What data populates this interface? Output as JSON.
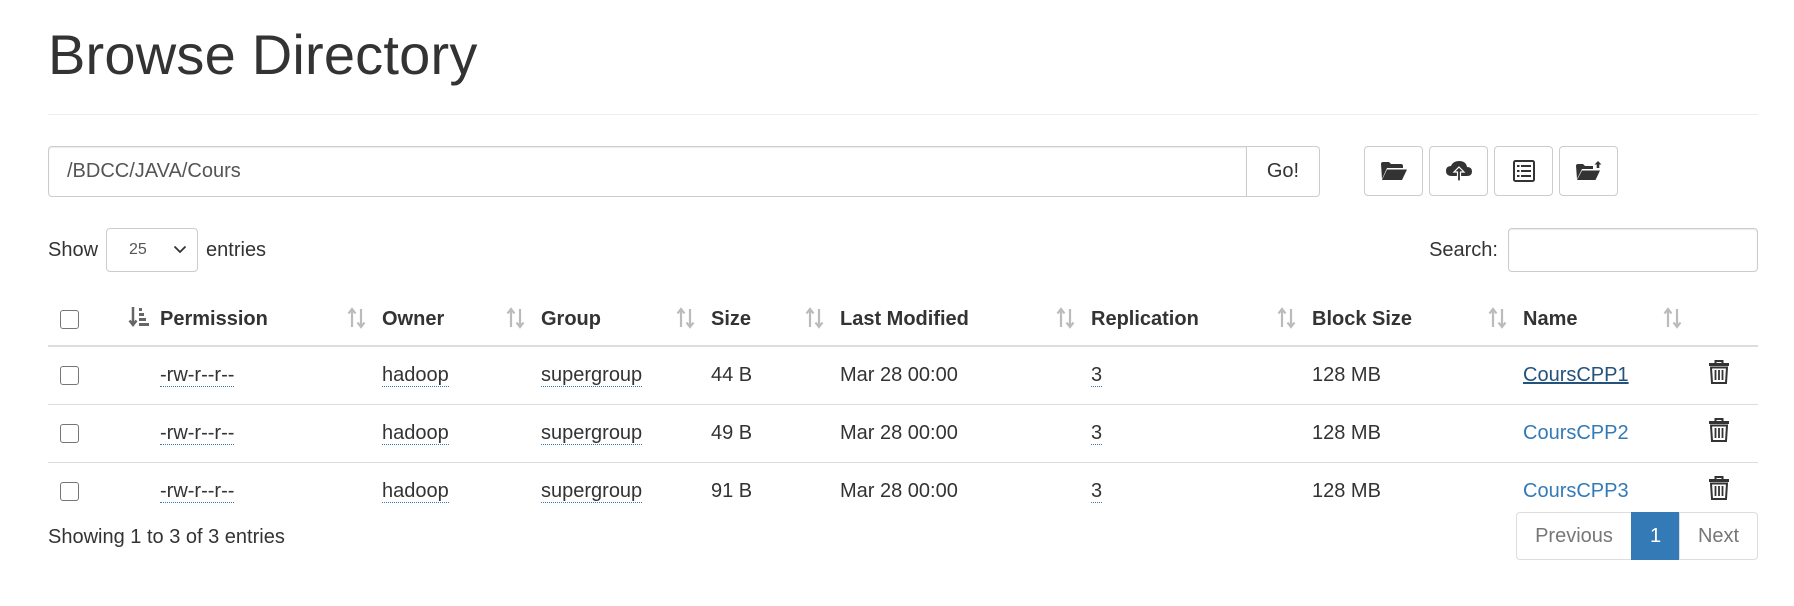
{
  "page": {
    "title": "Browse Directory"
  },
  "pathbar": {
    "path_value": "/BDCC/JAVA/Cours",
    "go_label": "Go!"
  },
  "toolbar": {
    "icons": [
      "folder-open-icon",
      "cloud-upload-icon",
      "list-alt-icon",
      "folder-move-icon"
    ]
  },
  "length": {
    "show_label": "Show",
    "selected": "25",
    "entries_label": "entries"
  },
  "search": {
    "label": "Search:",
    "value": ""
  },
  "table": {
    "columns": [
      "Permission",
      "Owner",
      "Group",
      "Size",
      "Last Modified",
      "Replication",
      "Block Size",
      "Name"
    ],
    "rows": [
      {
        "permission": "-rw-r--r--",
        "owner": "hadoop",
        "group": "supergroup",
        "size": "44 B",
        "modified": "Mar 28 00:00",
        "replication": "3",
        "block_size": "128 MB",
        "name": "CoursCPP1"
      },
      {
        "permission": "-rw-r--r--",
        "owner": "hadoop",
        "group": "supergroup",
        "size": "49 B",
        "modified": "Mar 28 00:00",
        "replication": "3",
        "block_size": "128 MB",
        "name": "CoursCPP2"
      },
      {
        "permission": "-rw-r--r--",
        "owner": "hadoop",
        "group": "supergroup",
        "size": "91 B",
        "modified": "Mar 28 00:00",
        "replication": "3",
        "block_size": "128 MB",
        "name": "CoursCPP3"
      }
    ]
  },
  "footer": {
    "info": "Showing 1 to 3 of 3 entries",
    "previous_label": "Previous",
    "current_page": "1",
    "next_label": "Next"
  },
  "colors": {
    "link": "#337ab7",
    "active_page": "#337ab7",
    "border": "#dddddd"
  }
}
